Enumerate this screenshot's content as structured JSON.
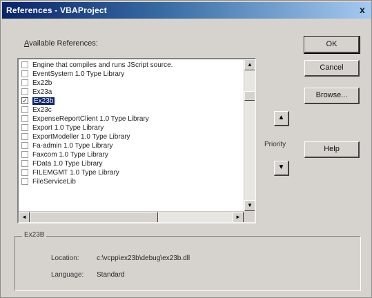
{
  "window": {
    "title": "References - VBAProject",
    "close_glyph": "x"
  },
  "available_label": {
    "accel": "A",
    "rest": "vailable References:"
  },
  "references": [
    {
      "label": "Engine that compiles and runs JScript source.",
      "checked": false
    },
    {
      "label": "EventSystem 1.0 Type Library",
      "checked": false
    },
    {
      "label": "Ex22b",
      "checked": false
    },
    {
      "label": "Ex23a",
      "checked": false
    },
    {
      "label": "Ex23b",
      "checked": true,
      "selected": true
    },
    {
      "label": "Ex23c",
      "checked": false
    },
    {
      "label": "ExpenseReportClient 1.0 Type Library",
      "checked": false
    },
    {
      "label": "Export 1.0 Type Library",
      "checked": false
    },
    {
      "label": "ExportModeller 1.0 Type Library",
      "checked": false
    },
    {
      "label": "Fa-admin 1.0 Type Library",
      "checked": false
    },
    {
      "label": "Faxcom 1.0 Type Library",
      "checked": false
    },
    {
      "label": "FData 1.0 Type Library",
      "checked": false
    },
    {
      "label": "FILEMGMT 1.0 Type Library",
      "checked": false
    },
    {
      "label": "FileServiceLib",
      "checked": false
    }
  ],
  "priority": {
    "label": "Priority",
    "up_glyph": "▲",
    "down_glyph": "▼"
  },
  "buttons": {
    "ok": "OK",
    "cancel": "Cancel",
    "browse": "Browse...",
    "help": "Help"
  },
  "details": {
    "group_title": "Ex23B",
    "location_label": "Location:",
    "location_value": "c:\\vcpp\\ex23b\\debug\\ex23b.dll",
    "language_label": "Language:",
    "language_value": "Standard"
  },
  "scroll_glyphs": {
    "up": "▲",
    "down": "▼",
    "left": "◄",
    "right": "►"
  }
}
